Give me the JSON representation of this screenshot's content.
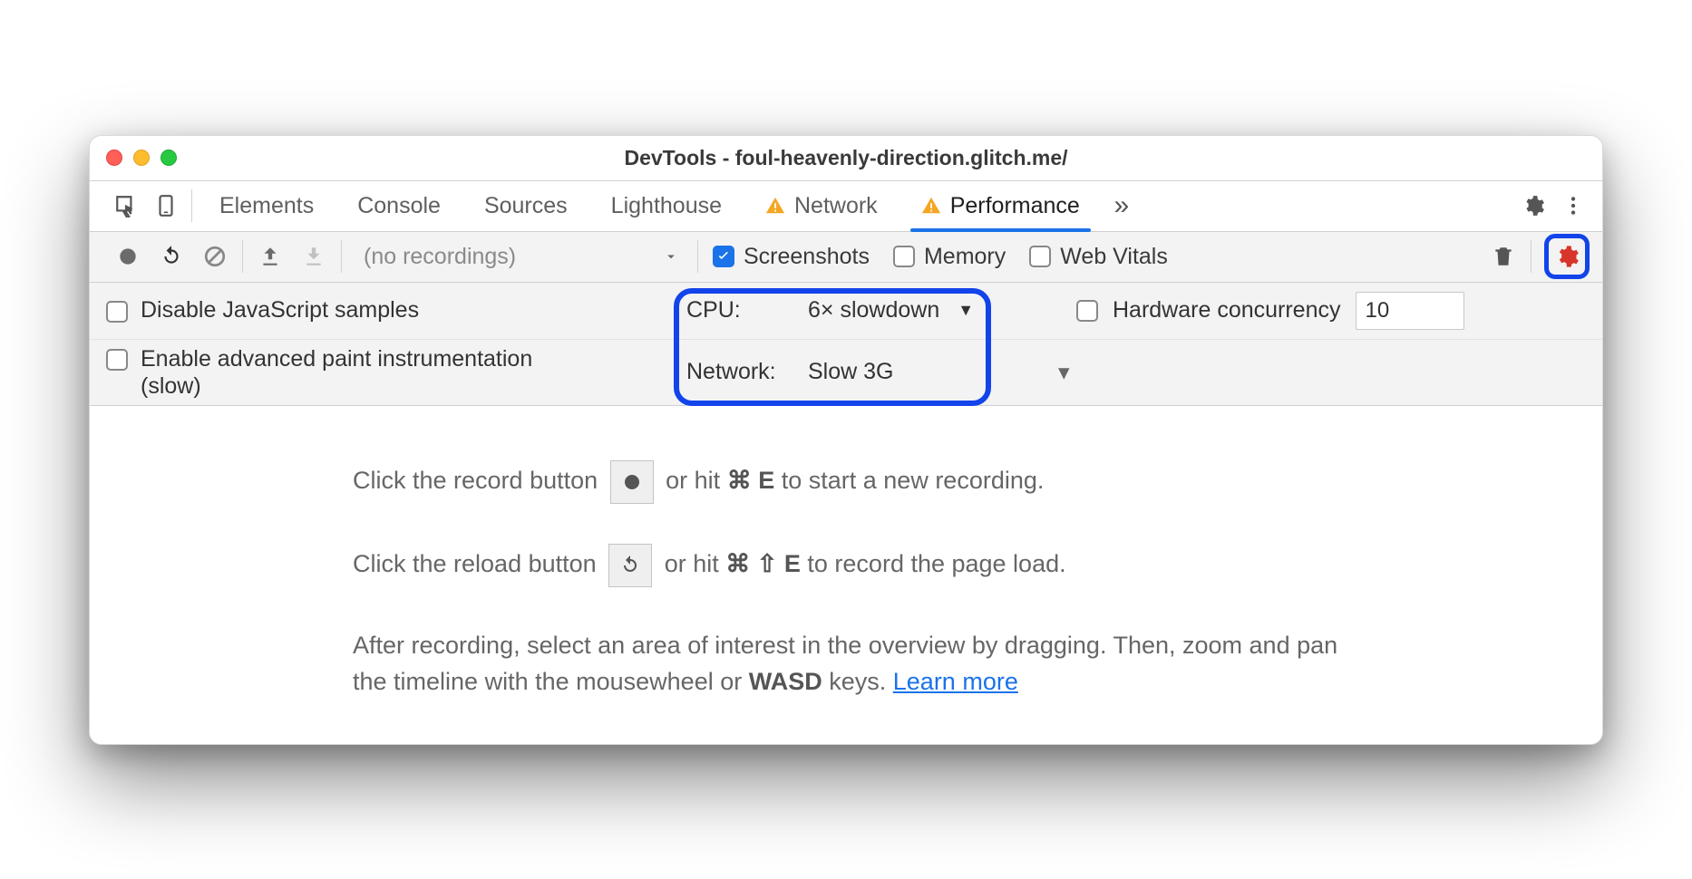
{
  "window": {
    "title": "DevTools - foul-heavenly-direction.glitch.me/"
  },
  "tabs": {
    "items": [
      {
        "label": "Elements",
        "warn": false,
        "active": false
      },
      {
        "label": "Console",
        "warn": false,
        "active": false
      },
      {
        "label": "Sources",
        "warn": false,
        "active": false
      },
      {
        "label": "Lighthouse",
        "warn": false,
        "active": false
      },
      {
        "label": "Network",
        "warn": true,
        "active": false
      },
      {
        "label": "Performance",
        "warn": true,
        "active": true
      }
    ],
    "more": "»"
  },
  "toolbar": {
    "recordings_label": "(no recordings)",
    "screenshots_label": "Screenshots",
    "memory_label": "Memory",
    "webvitals_label": "Web Vitals"
  },
  "settings": {
    "disable_js_label": "Disable JavaScript samples",
    "paint_instr_label": "Enable advanced paint instrumentation (slow)",
    "cpu_label": "CPU:",
    "cpu_value": "6× slowdown",
    "network_label": "Network:",
    "network_value": "Slow 3G",
    "hwconc_label": "Hardware concurrency",
    "hwconc_value": "10"
  },
  "content": {
    "line1a": "Click the record button ",
    "line1b": " or hit ",
    "line1_key1": "⌘",
    "line1_key2": "E",
    "line1c": " to start a new recording.",
    "line2a": "Click the reload button ",
    "line2b": " or hit ",
    "line2_key1": "⌘",
    "line2_key2": "⇧",
    "line2_key3": "E",
    "line2c": " to record the page load.",
    "line3a": "After recording, select an area of interest in the overview by dragging. Then, zoom and pan the timeline with the mousewheel or ",
    "line3_key": "WASD",
    "line3b": " keys. ",
    "learn_more": "Learn more"
  }
}
